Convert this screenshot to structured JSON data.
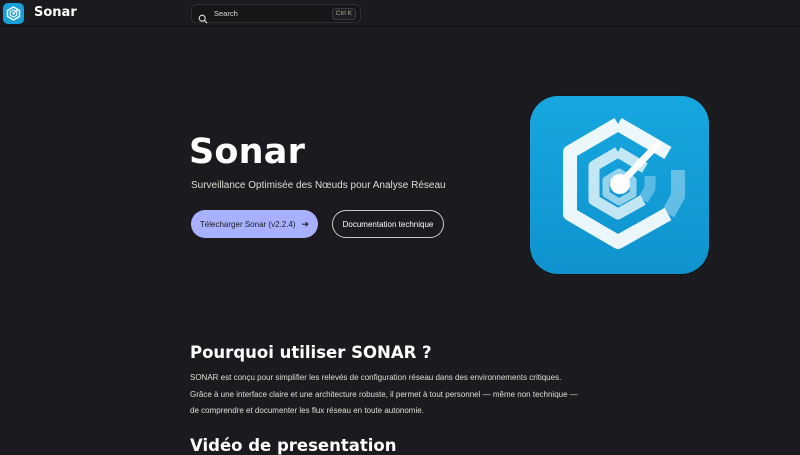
{
  "nav": {
    "brand": "Sonar",
    "search_label": "Search",
    "search_shortcut": "Ctrl K"
  },
  "hero": {
    "title": "Sonar",
    "tagline": "Surveillance Optimisée des Nœuds pour Analyse Réseau",
    "download_label": "Télecharger Sonar (v2.2.4)",
    "download_icon": "arrow-right-icon",
    "docs_label": "Documentation technique"
  },
  "why": {
    "title": "Pourquoi utiliser SONAR ?",
    "lines": [
      "SONAR est conçu pour simplifier les relevés de configuration réseau dans des environnements critiques.",
      "Grâce à une interface claire et une architecture robuste, il permet à tout personnel — même non technique —",
      "de comprendre et documenter les flux réseau en toute autonomie."
    ]
  },
  "video": {
    "title": "Vidéo de presentation"
  },
  "colors": {
    "background": "#1b1b1f",
    "accent": "#a8b1ff",
    "logo_blue": "#1aa0d8"
  }
}
